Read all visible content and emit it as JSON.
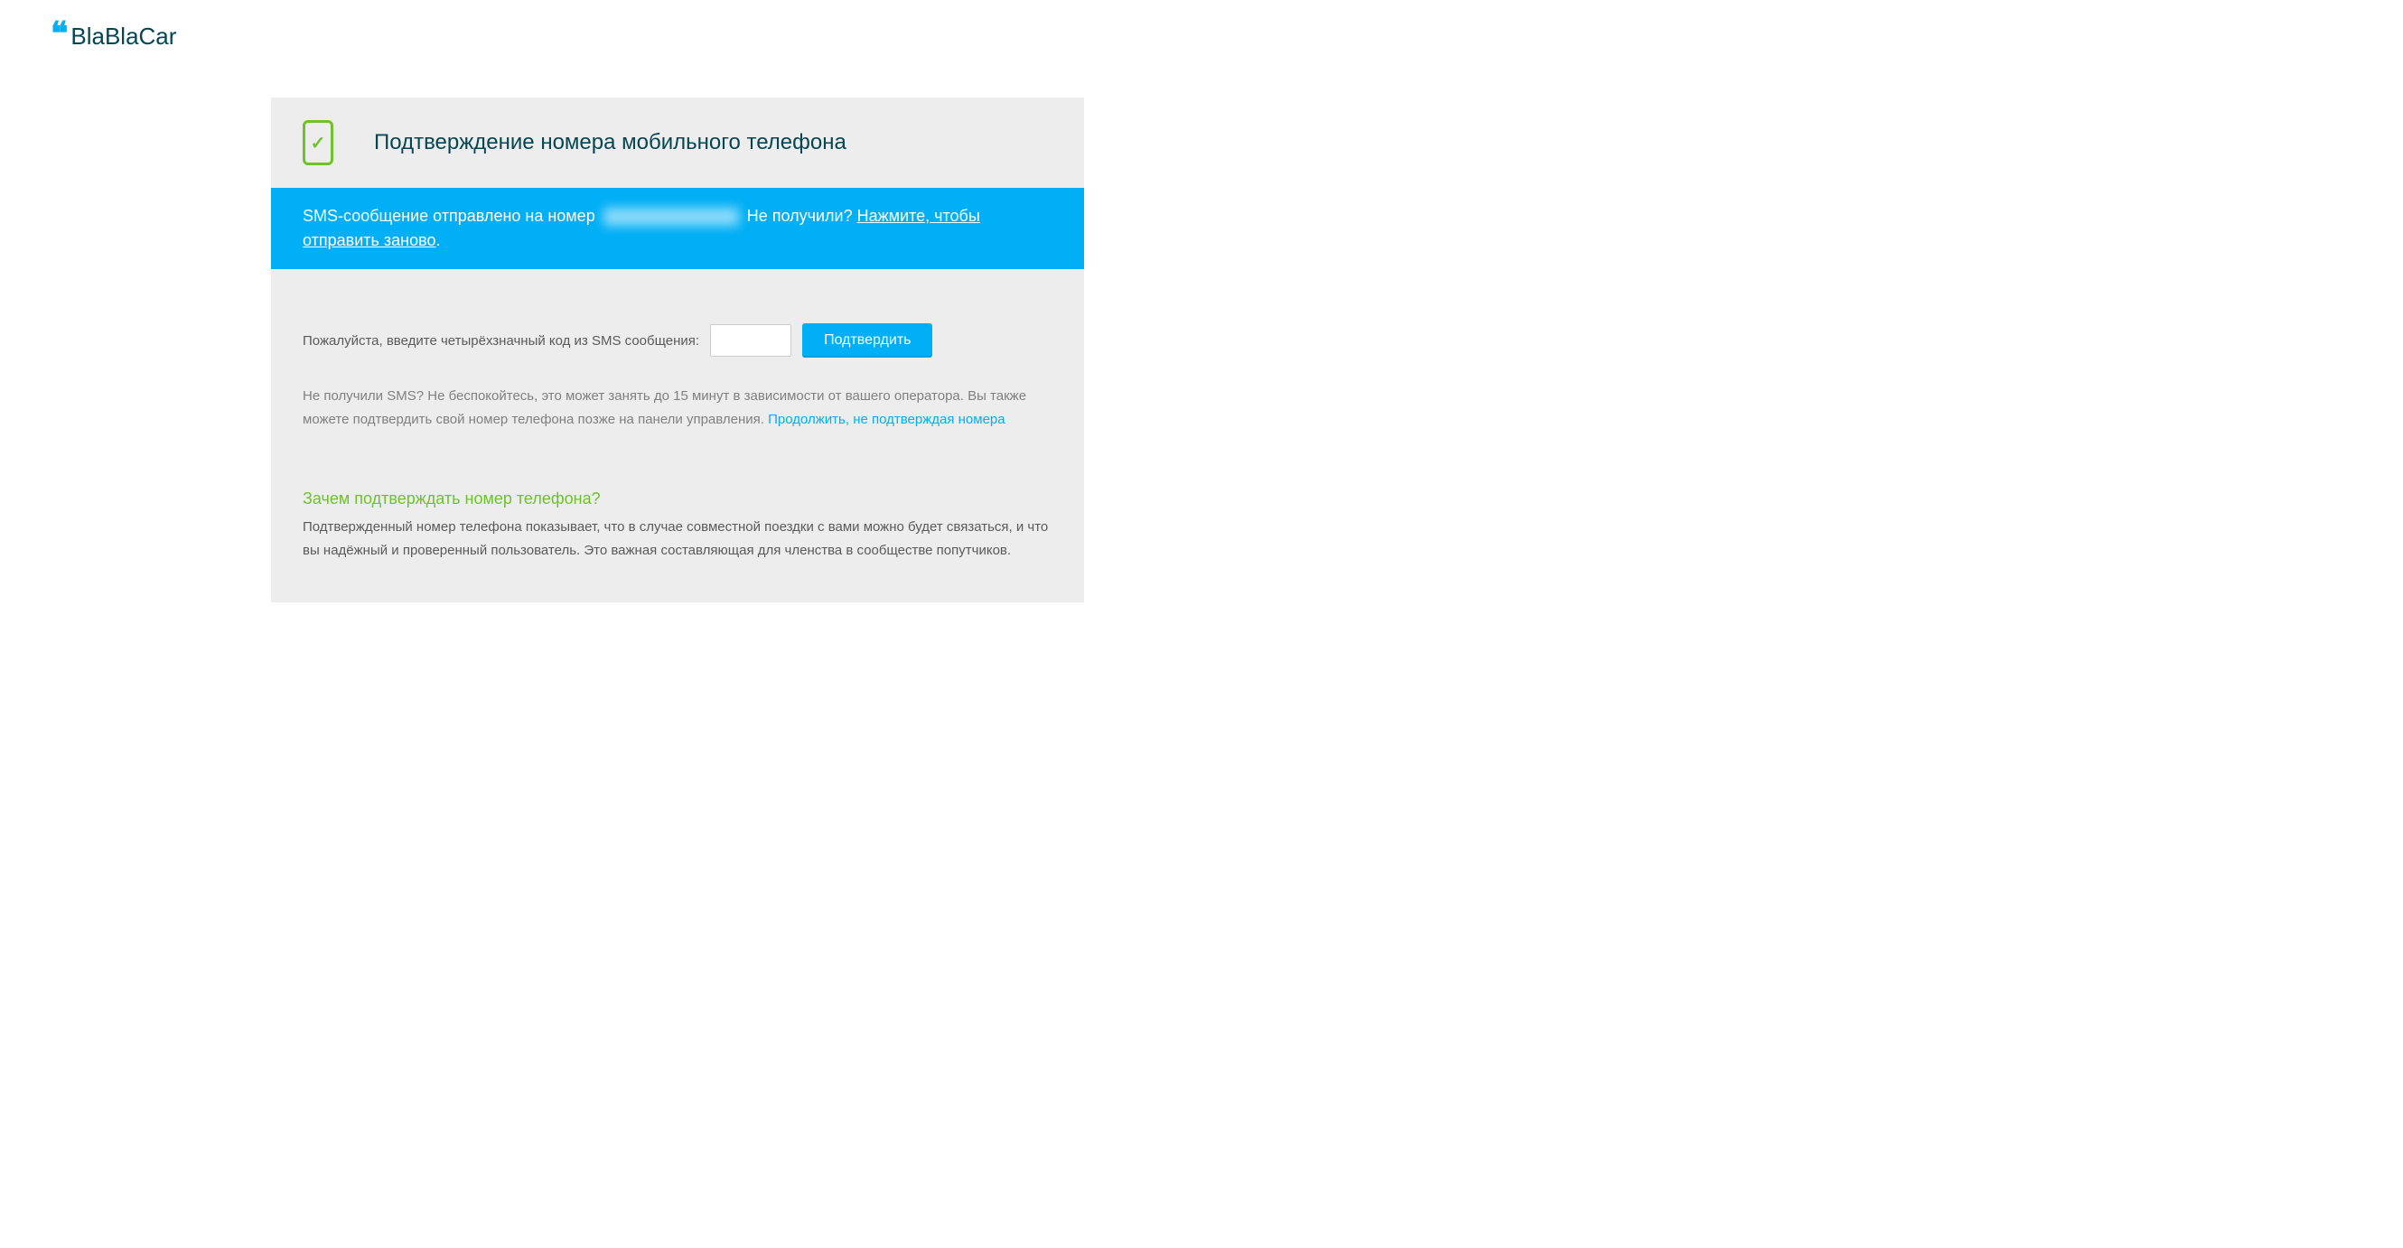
{
  "brand": {
    "name": "BlaBlaCar"
  },
  "header": {
    "title": "Подтверждение номера мобильного телефона"
  },
  "banner": {
    "text_before": "SMS-сообщение отправлено на номер ",
    "text_after": " Не получили? ",
    "resend_link": "Нажмите, чтобы отправить заново",
    "period": "."
  },
  "form": {
    "label": "Пожалуйста, введите четырёхзначный код из SMS сообщения:",
    "confirm_button": "Подтвердить"
  },
  "help": {
    "text": "Не получили SMS? Не беспокойтесь, это может занять до 15 минут в зависимости от вашего оператора. Вы также можете подтвердить свой номер телефона позже на панели управления. ",
    "continue_link": "Продолжить, не подтверждая номера"
  },
  "why": {
    "title": "Зачем подтверждать номер телефона?",
    "text": "Подтвержденный номер телефона показывает, что в случае совместной поездки с вами можно будет связаться, и что вы надёжный и проверенный пользователь. Это важная составляющая для членства в сообществе попутчиков."
  }
}
